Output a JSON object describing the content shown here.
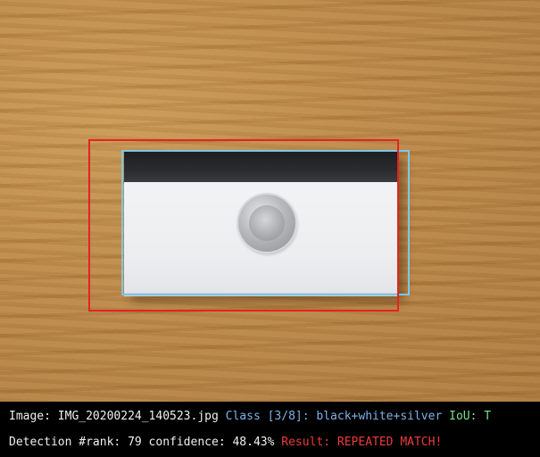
{
  "info": {
    "image_label": "Image:",
    "image_name": "IMG_20200224_140523.jpg",
    "class_label": "Class",
    "class_index": "[3/8]:",
    "class_name": "black+white+silver",
    "iou_label": "IoU:",
    "iou_value": "T",
    "detection_label": "Detection #rank:",
    "rank_value": "79",
    "confidence_label": "confidence:",
    "confidence_value": "48.43%",
    "result_label": "Result:",
    "result_value": "REPEATED MATCH!"
  },
  "colors": {
    "ground_truth_box": "#7ec6e6",
    "prediction_box": "#e62222",
    "class_text": "#7fb2e8",
    "iou_text": "#7ee08a",
    "result_text": "#f03a3a"
  }
}
